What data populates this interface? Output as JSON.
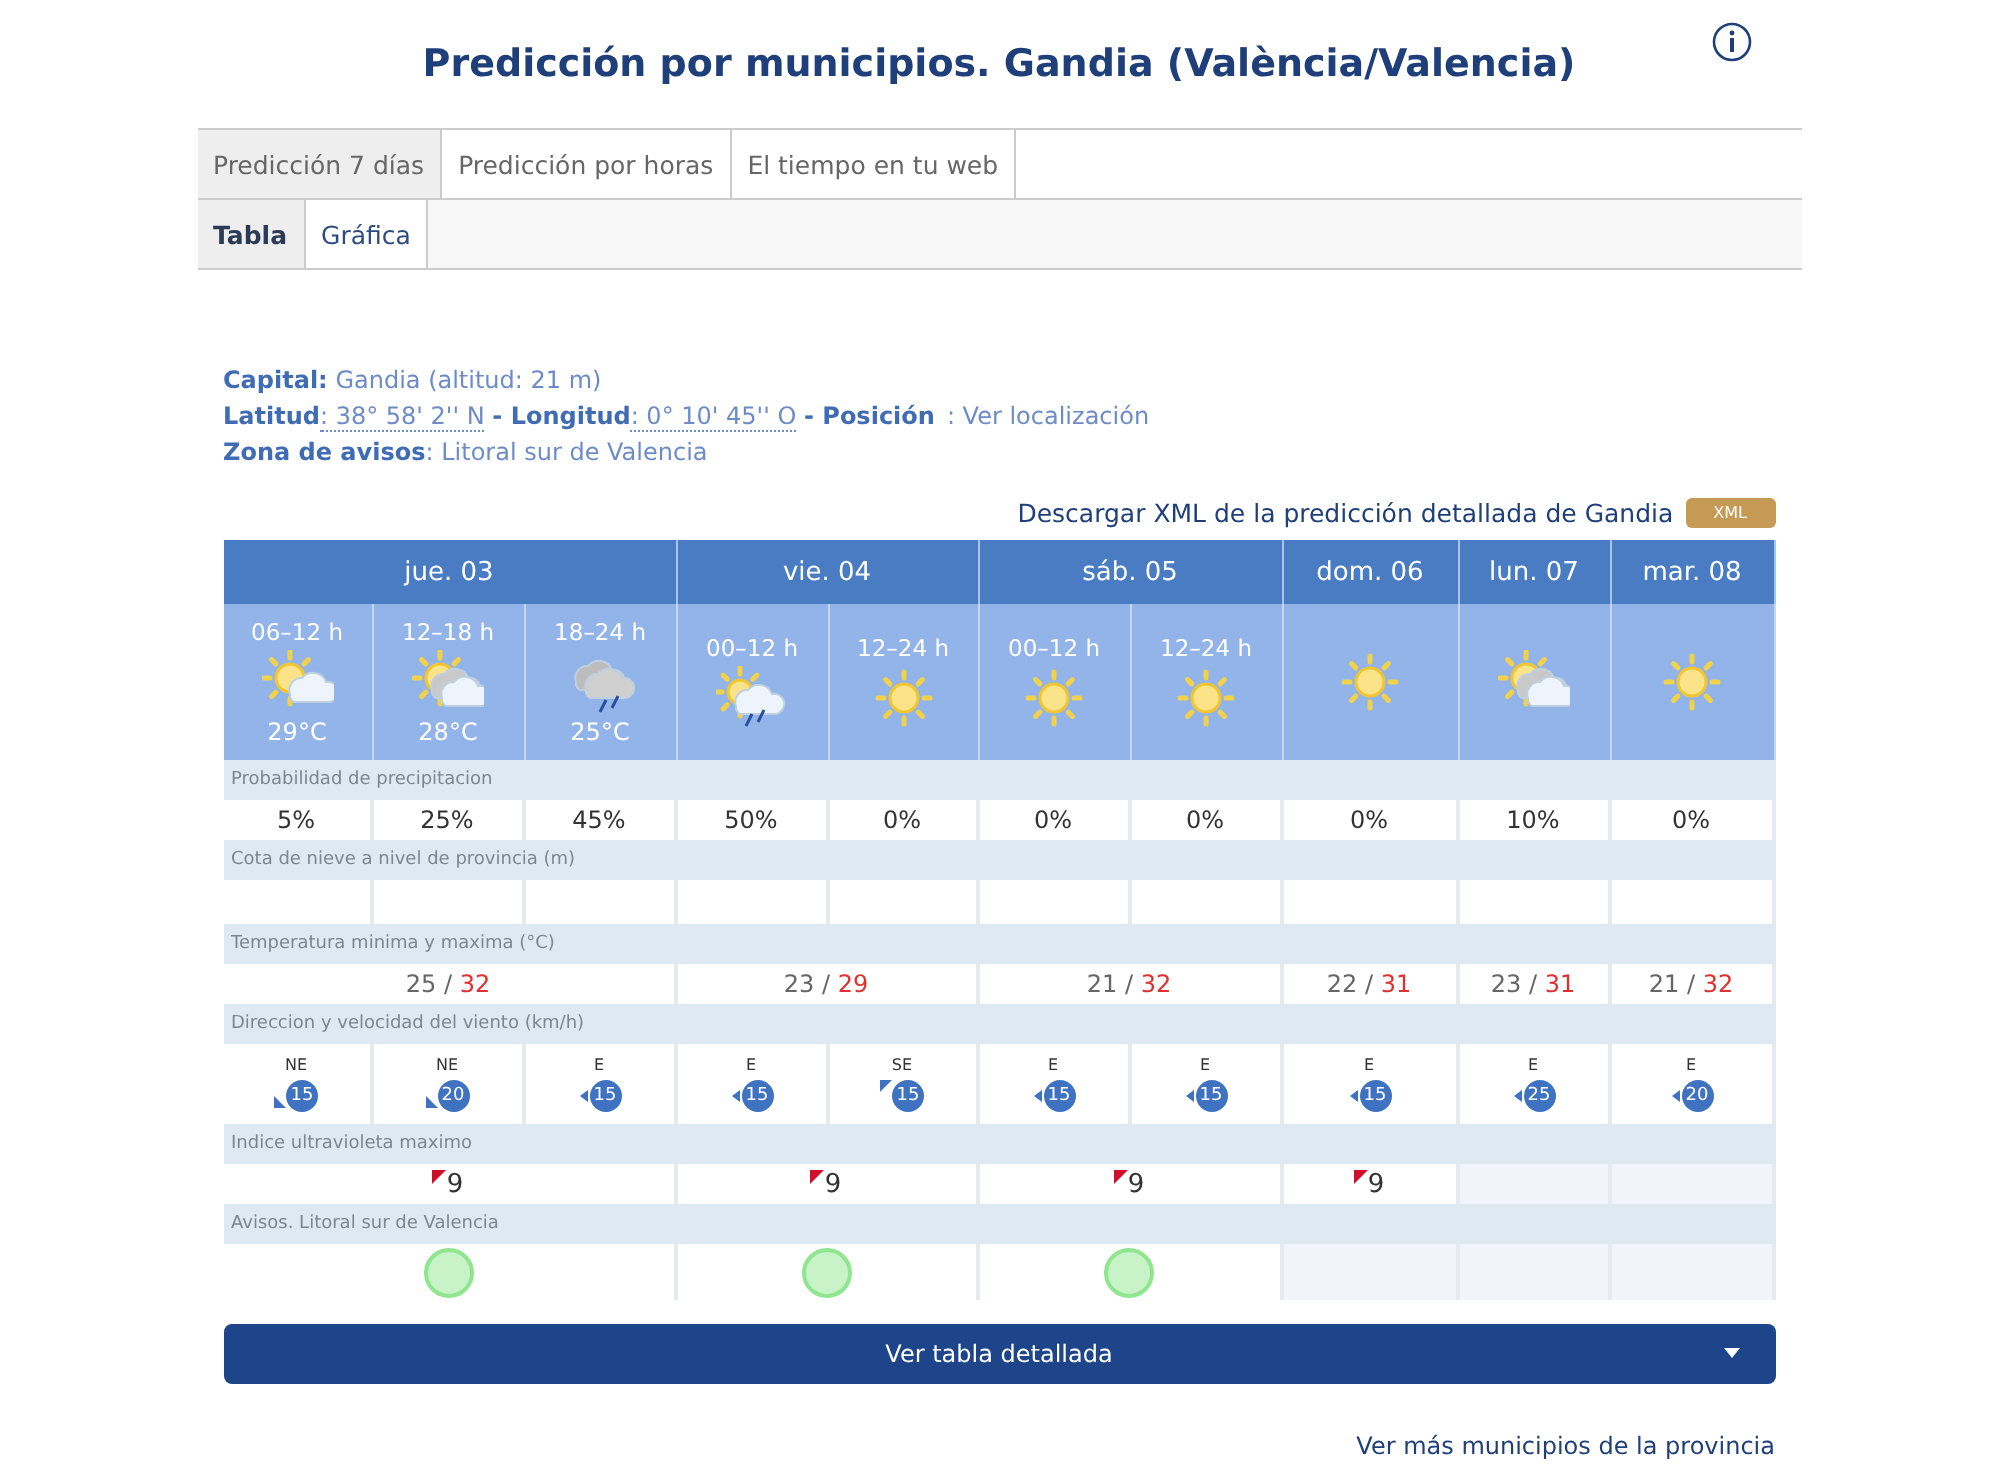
{
  "title": "Predicción por municipios. Gandia (València/Valencia)",
  "tabs": [
    {
      "label": "Predicción 7 días",
      "selected": true
    },
    {
      "label": "Predicción por horas",
      "selected": false
    },
    {
      "label": "El tiempo en tu web",
      "selected": false
    }
  ],
  "subtabs": [
    {
      "label": "Tabla",
      "selected": true
    },
    {
      "label": "Gráfica",
      "selected": false
    }
  ],
  "info": {
    "capital_label": "Capital:",
    "capital": "Gandia (altitud: 21 m)",
    "lat_label": "Latitud",
    "lat": ": 38° 58' 2'' N",
    "lon_label": "- Longitud",
    "lon": ": 0° 10' 45'' O",
    "pos_label": "- Posición",
    "pos_link": ": Ver localización",
    "zone_label": "Zona de avisos",
    "zone": ": Litoral sur de Valencia"
  },
  "xml": {
    "text": "Descargar XML de la predicción detallada de Gandia",
    "badge": "XML"
  },
  "row_labels": {
    "precipitation": "Probabilidad de precipitacion",
    "snow": "Cota de nieve a nivel de provincia (m)",
    "temperature": "Temperatura minima y maxima (°C)",
    "wind": "Direccion y velocidad del viento (km/h)",
    "uv": "Indice ultravioleta maximo",
    "warnings": "Avisos. Litoral sur de Valencia"
  },
  "days": [
    {
      "label": "jue. 03",
      "min": "25 /",
      "max": "32",
      "uv": "9",
      "uv_available": true,
      "warning": true,
      "periods": [
        {
          "range": "06–12 h",
          "kind": "sun-cloud",
          "temp": "29°C",
          "precip": "5%",
          "wind": {
            "direction": "NE",
            "speed": "15",
            "kind": "bottom-left"
          }
        },
        {
          "range": "12–18 h",
          "kind": "sun-grey-cloud",
          "temp": "28°C",
          "precip": "25%",
          "wind": {
            "direction": "NE",
            "speed": "20",
            "kind": "bottom-left"
          }
        },
        {
          "range": "18–24 h",
          "kind": "rain-cloud",
          "temp": "25°C",
          "precip": "45%",
          "wind": {
            "direction": "E",
            "speed": "15",
            "kind": "left"
          }
        }
      ]
    },
    {
      "label": "vie. 04",
      "min": "23 /",
      "max": "29",
      "uv": "9",
      "uv_available": true,
      "warning": true,
      "periods": [
        {
          "range": "00–12 h",
          "kind": "sun-rain",
          "precip": "50%",
          "wind": {
            "direction": "E",
            "speed": "15",
            "kind": "left"
          }
        },
        {
          "range": "12–24 h",
          "kind": "sun",
          "precip": "0%",
          "wind": {
            "direction": "SE",
            "speed": "15",
            "kind": "top-left"
          }
        }
      ]
    },
    {
      "label": "sáb. 05",
      "min": "21 /",
      "max": "32",
      "uv": "9",
      "uv_available": true,
      "warning": true,
      "periods": [
        {
          "range": "00–12 h",
          "kind": "sun",
          "precip": "0%",
          "wind": {
            "direction": "E",
            "speed": "15",
            "kind": "left"
          }
        },
        {
          "range": "12–24 h",
          "kind": "sun",
          "precip": "0%",
          "wind": {
            "direction": "E",
            "speed": "15",
            "kind": "left"
          }
        }
      ]
    },
    {
      "label": "dom. 06",
      "min": "22 /",
      "max": "31",
      "uv": "9",
      "uv_available": true,
      "warning": false,
      "periods": [
        {
          "kind": "sun",
          "precip": "0%",
          "wind": {
            "direction": "E",
            "speed": "15",
            "kind": "left"
          }
        }
      ]
    },
    {
      "label": "lun. 07",
      "min": "23 /",
      "max": "31",
      "uv_available": false,
      "warning": false,
      "periods": [
        {
          "kind": "sun-grey-cloud",
          "precip": "10%",
          "wind": {
            "direction": "E",
            "speed": "25",
            "kind": "left"
          }
        }
      ]
    },
    {
      "label": "mar. 08",
      "min": "21 /",
      "max": "32",
      "uv_available": false,
      "warning": false,
      "periods": [
        {
          "kind": "sun",
          "precip": "0%",
          "wind": {
            "direction": "E",
            "speed": "20",
            "kind": "left"
          }
        }
      ]
    }
  ],
  "detail_button": "Ver tabla detallada",
  "more_link": "Ver más municipios de la provincia"
}
